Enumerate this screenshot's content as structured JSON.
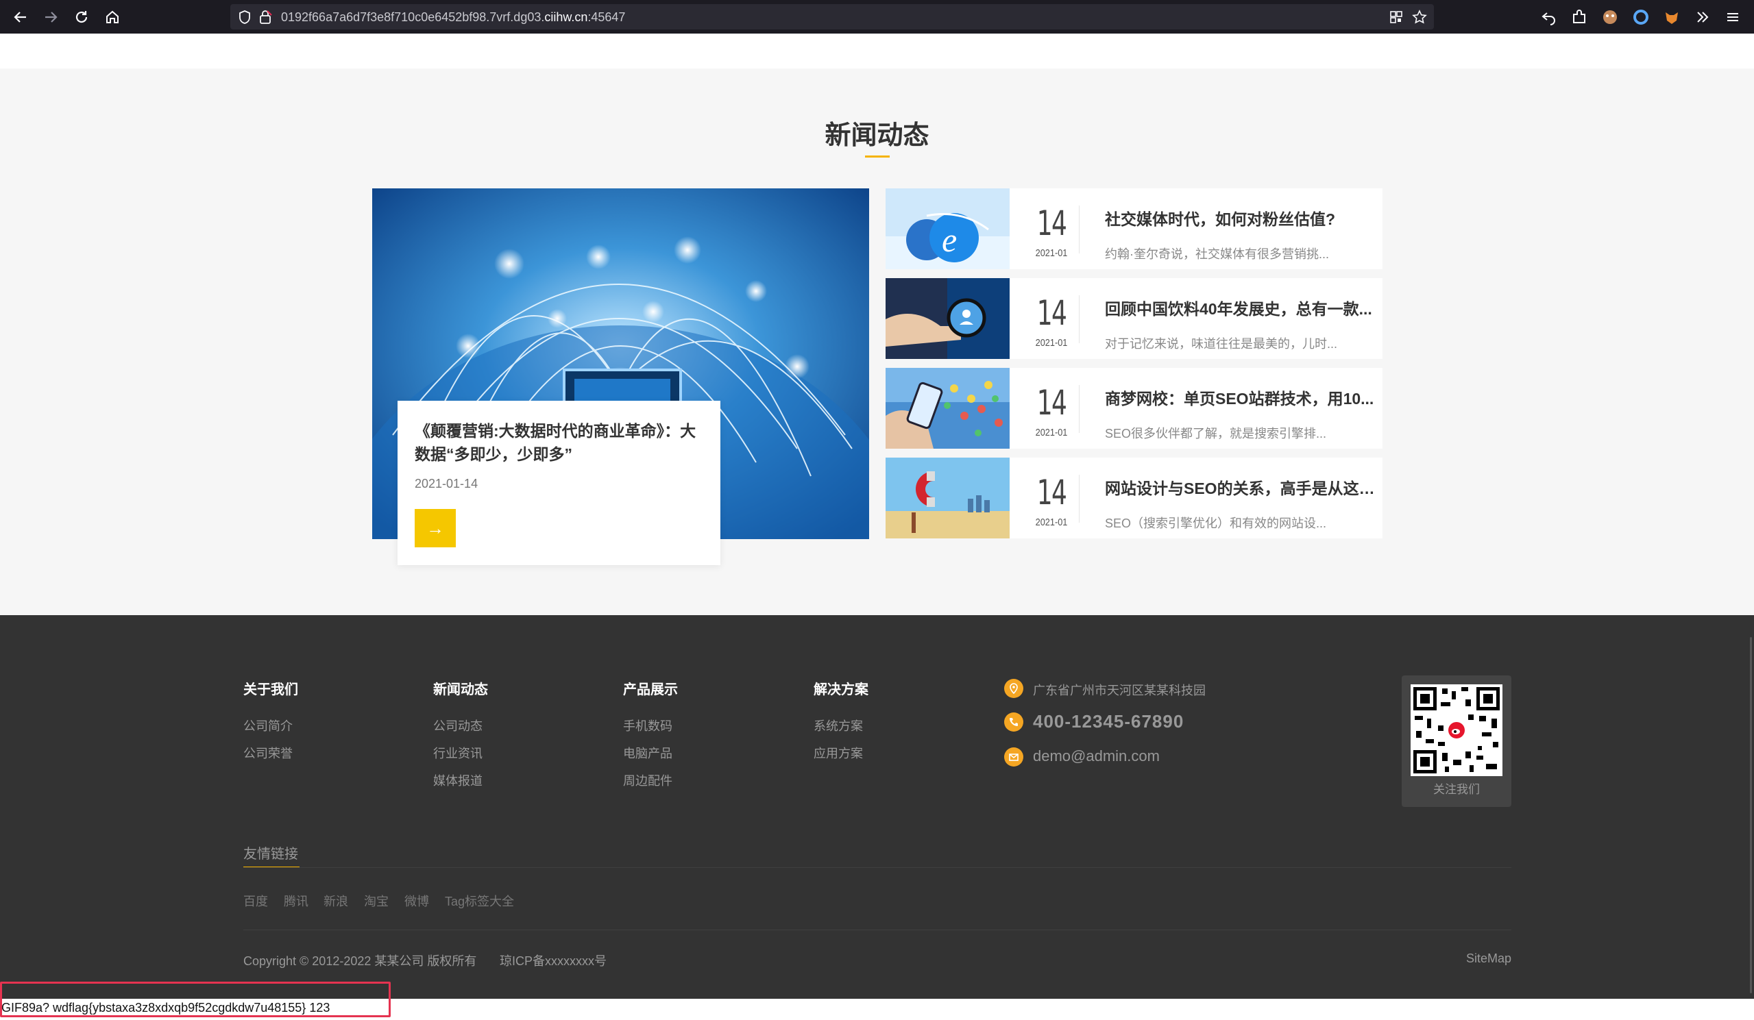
{
  "browser": {
    "url_prefix": "0192f66a7a6d7f3e8f710c0e6452bf98.7vrf.dg03.",
    "url_domain": "ciihw.cn",
    "url_port": ":45647"
  },
  "news_section": {
    "title": "新闻动态",
    "featured": {
      "title": "《颠覆营销:大数据时代的商业革命》：大数据“多即少，少即多”",
      "date": "2021-01-14",
      "button_symbol": "→"
    },
    "items": [
      {
        "day": "14",
        "ym": "2021-01",
        "title": "社交媒体时代，如何对粉丝估值?",
        "desc": "约翰·奎尔奇说，社交媒体有很多营销挑..."
      },
      {
        "day": "14",
        "ym": "2021-01",
        "title": "回顾中国饮料40年发展史，总有一款...",
        "desc": "对于记忆来说，味道往往是最美的，儿时..."
      },
      {
        "day": "14",
        "ym": "2021-01",
        "title": "商梦网校：单页SEO站群技术，用10...",
        "desc": "SEO很多伙伴都了解，就是搜索引擎排..."
      },
      {
        "day": "14",
        "ym": "2021-01",
        "title": "网站设计与SEO的关系，高手是从这4...",
        "desc": "SEO（搜索引擎优化）和有效的网站设..."
      }
    ]
  },
  "footer": {
    "columns": [
      {
        "title": "关于我们",
        "links": [
          "公司简介",
          "公司荣誉"
        ]
      },
      {
        "title": "新闻动态",
        "links": [
          "公司动态",
          "行业资讯",
          "媒体报道"
        ]
      },
      {
        "title": "产品展示",
        "links": [
          "手机数码",
          "电脑产品",
          "周边配件"
        ]
      },
      {
        "title": "解决方案",
        "links": [
          "系统方案",
          "应用方案"
        ]
      }
    ],
    "contact": {
      "address": "广东省广州市天河区某某科技园",
      "phone": "400-12345-67890",
      "email": "demo@admin.com"
    },
    "qr_label": "关注我们",
    "friend_links_title": "友情链接",
    "friend_links": [
      "百度",
      "腾讯",
      "新浪",
      "淘宝",
      "微博",
      "Tag标签大全"
    ],
    "copyright": "Copyright © 2012-2022 某某公司 版权所有",
    "icp": "琼ICP备xxxxxxxx号",
    "sitemap": "SiteMap"
  },
  "status_bar": {
    "text": "GIF89a? wdflag{ybstaxa3z8xdxqb9f52cgdkdw7u48155} 123"
  },
  "colors": {
    "accent": "#f5c700",
    "contact_icon": "#f5a623",
    "footer_bg": "#333333",
    "highlight_box": "#e53350"
  }
}
